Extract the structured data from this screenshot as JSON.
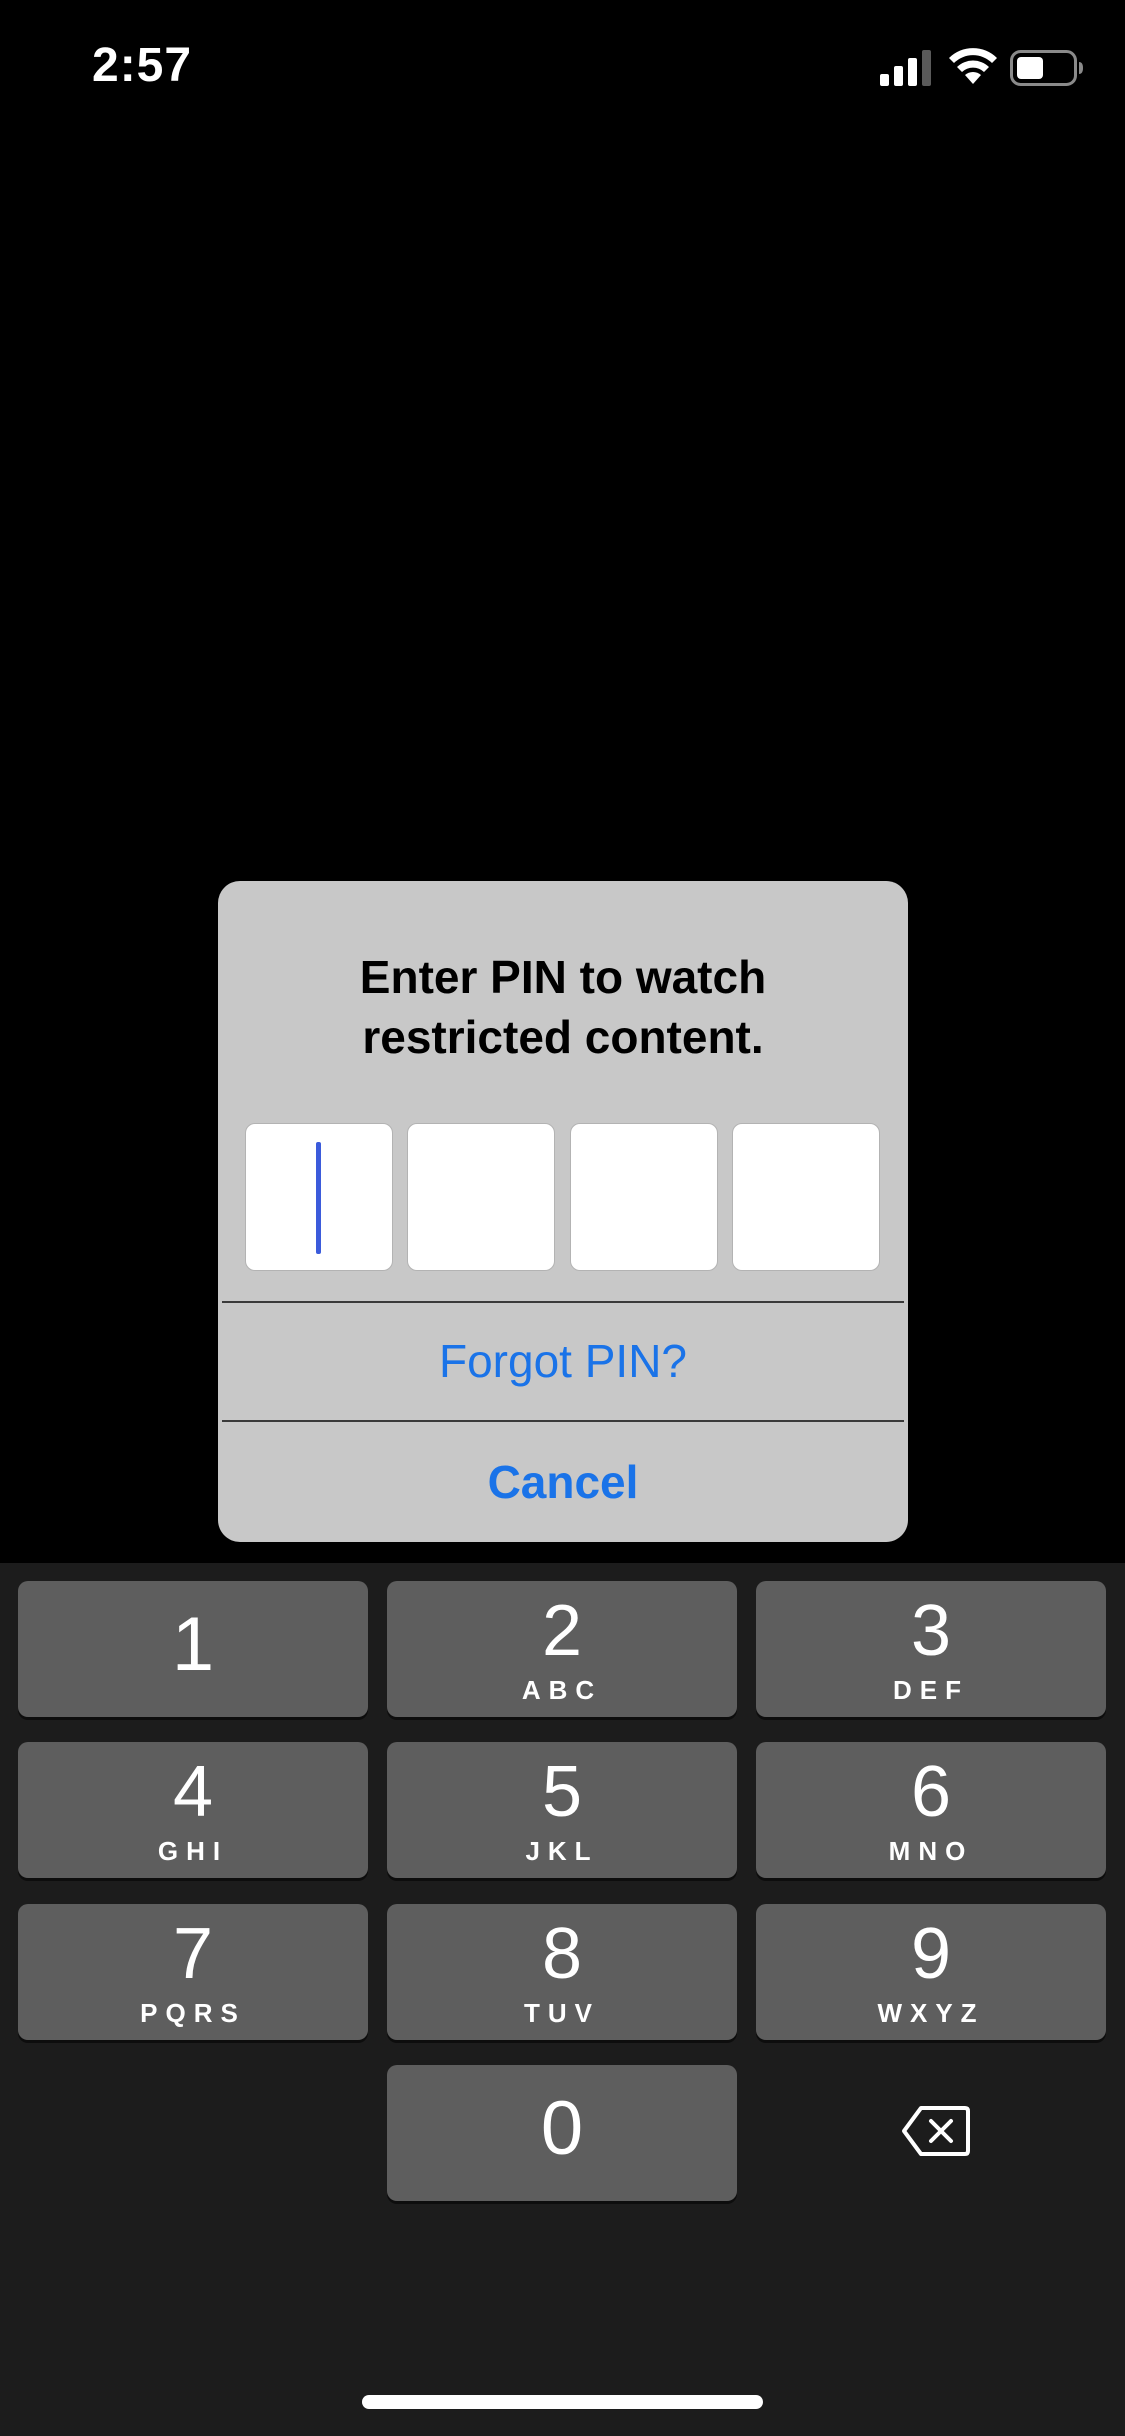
{
  "status_bar": {
    "time": "2:57",
    "signal_icon": "cellular-signal-icon",
    "wifi_icon": "wifi-icon",
    "battery_icon": "battery-icon"
  },
  "dialog": {
    "title": "Enter PIN to watch\nrestricted content.",
    "pin_length": 4,
    "pin_digits": [
      "",
      "",
      "",
      ""
    ],
    "focused_index": 0,
    "forgot_label": "Forgot PIN?",
    "cancel_label": "Cancel",
    "accent_color": "#1a73e8",
    "caret_color": "#3b5bdb"
  },
  "keypad": {
    "keys": [
      {
        "digit": "1",
        "letters": ""
      },
      {
        "digit": "2",
        "letters": "ABC"
      },
      {
        "digit": "3",
        "letters": "DEF"
      },
      {
        "digit": "4",
        "letters": "GHI"
      },
      {
        "digit": "5",
        "letters": "JKL"
      },
      {
        "digit": "6",
        "letters": "MNO"
      },
      {
        "digit": "7",
        "letters": "PQRS"
      },
      {
        "digit": "8",
        "letters": "TUV"
      },
      {
        "digit": "9",
        "letters": "WXYZ"
      },
      {
        "digit": "0",
        "letters": ""
      }
    ],
    "delete_icon": "backspace-icon"
  }
}
